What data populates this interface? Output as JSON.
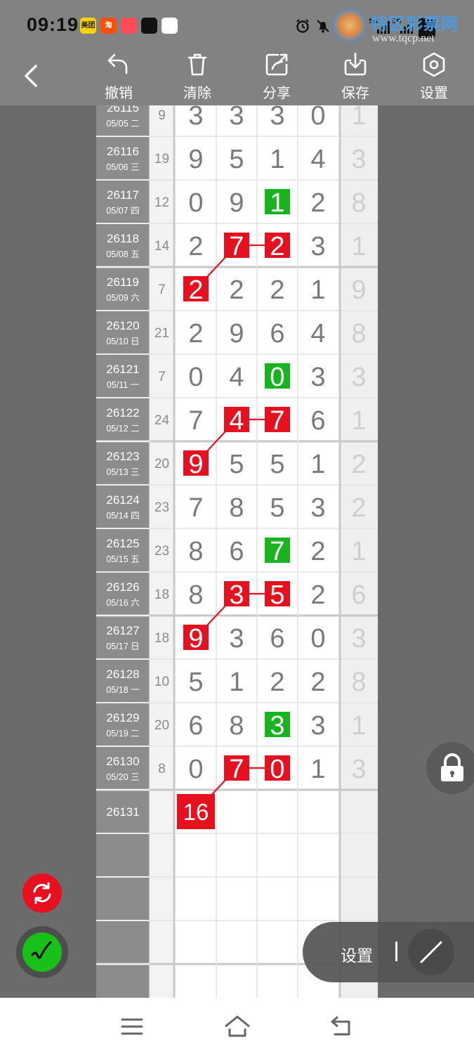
{
  "status_bar": {
    "time": "09:19",
    "apps": [
      {
        "icon": "meituan-icon",
        "label": "美团",
        "color": "#ffd100",
        "text_color": "#222"
      },
      {
        "icon": "taobao-icon",
        "label": "淘",
        "color": "#ff5000",
        "text_color": "#fff"
      },
      {
        "icon": "kuaishou-icon",
        "label": "",
        "color": "#ff4a5a",
        "text_color": "#fff"
      },
      {
        "icon": "douyin-icon",
        "label": "",
        "color": "#111111",
        "text_color": "#fff"
      },
      {
        "icon": "baidu-icon",
        "label": "",
        "color": "#ffffff",
        "text_color": "#2b5fd9"
      }
    ],
    "right_icons": [
      "alarm-icon",
      "mute-icon",
      "5g-signal-icon",
      "5g-signal-icon",
      "battery-icon"
    ]
  },
  "watermark": {
    "title": "特区彩票网",
    "url": "www.tqcp.net"
  },
  "toolbar": {
    "back_icon": "back-arrow-icon",
    "buttons": [
      {
        "icon": "undo-icon",
        "label": "撤销"
      },
      {
        "icon": "trash-icon",
        "label": "清除"
      },
      {
        "icon": "share-icon",
        "label": "分享"
      },
      {
        "icon": "save-icon",
        "label": "保存"
      },
      {
        "icon": "settings-icon",
        "label": "设置"
      }
    ]
  },
  "colors": {
    "red": "#e8101e",
    "green": "#17b41d",
    "digit": "#7a7a7a",
    "sum_digit": "#cfcfcf",
    "issue_bg": "#8c8c8c",
    "sum_col_bg": "#efefef"
  },
  "table": {
    "first_row_partial": true,
    "rows": [
      {
        "issue": "26115",
        "date": "05/05 二",
        "sum": "9",
        "digits": [
          "3",
          "3",
          "3",
          "0"
        ],
        "extra": "1"
      },
      {
        "issue": "26116",
        "date": "05/06 三",
        "sum": "19",
        "digits": [
          "9",
          "5",
          "1",
          "4"
        ],
        "extra": "3"
      },
      {
        "issue": "26117",
        "date": "05/07 四",
        "sum": "12",
        "digits": [
          "0",
          "9",
          "1",
          "2"
        ],
        "extra": "8"
      },
      {
        "issue": "26118",
        "date": "05/08 五",
        "sum": "14",
        "digits": [
          "2",
          "7",
          "2",
          "3"
        ],
        "extra": "1"
      },
      {
        "issue": "26119",
        "date": "05/09 六",
        "sum": "7",
        "digits": [
          "2",
          "2",
          "2",
          "1"
        ],
        "extra": "9"
      },
      {
        "issue": "26120",
        "date": "05/10 日",
        "sum": "21",
        "digits": [
          "2",
          "9",
          "6",
          "4"
        ],
        "extra": "8"
      },
      {
        "issue": "26121",
        "date": "05/11 一",
        "sum": "7",
        "digits": [
          "0",
          "4",
          "0",
          "3"
        ],
        "extra": "3"
      },
      {
        "issue": "26122",
        "date": "05/12 二",
        "sum": "24",
        "digits": [
          "7",
          "4",
          "7",
          "6"
        ],
        "extra": "1"
      },
      {
        "issue": "26123",
        "date": "05/13 三",
        "sum": "20",
        "digits": [
          "9",
          "5",
          "5",
          "1"
        ],
        "extra": "2"
      },
      {
        "issue": "26124",
        "date": "05/14 四",
        "sum": "23",
        "digits": [
          "7",
          "8",
          "5",
          "3"
        ],
        "extra": "2"
      },
      {
        "issue": "26125",
        "date": "05/15 五",
        "sum": "23",
        "digits": [
          "8",
          "6",
          "7",
          "2"
        ],
        "extra": "1"
      },
      {
        "issue": "26126",
        "date": "05/16 六",
        "sum": "18",
        "digits": [
          "8",
          "3",
          "5",
          "2"
        ],
        "extra": "6"
      },
      {
        "issue": "26127",
        "date": "05/17 日",
        "sum": "18",
        "digits": [
          "9",
          "3",
          "6",
          "0"
        ],
        "extra": "3"
      },
      {
        "issue": "26128",
        "date": "05/18 一",
        "sum": "10",
        "digits": [
          "5",
          "1",
          "2",
          "2"
        ],
        "extra": "8"
      },
      {
        "issue": "26129",
        "date": "05/19 二",
        "sum": "20",
        "digits": [
          "6",
          "8",
          "3",
          "3"
        ],
        "extra": "1"
      },
      {
        "issue": "26130",
        "date": "05/20 三",
        "sum": "8",
        "digits": [
          "0",
          "7",
          "0",
          "1"
        ],
        "extra": "3"
      },
      {
        "issue": "26131",
        "date": "",
        "sum": "",
        "digits": [
          "16",
          "",
          "",
          ""
        ],
        "extra": ""
      },
      {
        "issue": "",
        "date": "",
        "sum": "",
        "digits": [
          "",
          "",
          "",
          ""
        ],
        "extra": ""
      },
      {
        "issue": "",
        "date": "",
        "sum": "",
        "digits": [
          "",
          "",
          "",
          ""
        ],
        "extra": ""
      },
      {
        "issue": "",
        "date": "",
        "sum": "",
        "digits": [
          "",
          "",
          "",
          ""
        ],
        "extra": ""
      },
      {
        "issue": "",
        "date": "",
        "sum": "",
        "digits": [
          "",
          "",
          "",
          ""
        ],
        "extra": ""
      }
    ],
    "highlights": [
      {
        "row": 2,
        "col": 2,
        "color": "green"
      },
      {
        "row": 3,
        "col": 1,
        "color": "red"
      },
      {
        "row": 3,
        "col": 2,
        "color": "red"
      },
      {
        "row": 4,
        "col": 0,
        "color": "red"
      },
      {
        "row": 6,
        "col": 2,
        "color": "green"
      },
      {
        "row": 7,
        "col": 1,
        "color": "red"
      },
      {
        "row": 7,
        "col": 2,
        "color": "red"
      },
      {
        "row": 8,
        "col": 0,
        "color": "red"
      },
      {
        "row": 10,
        "col": 2,
        "color": "green"
      },
      {
        "row": 11,
        "col": 1,
        "color": "red"
      },
      {
        "row": 11,
        "col": 2,
        "color": "red"
      },
      {
        "row": 12,
        "col": 0,
        "color": "red"
      },
      {
        "row": 14,
        "col": 2,
        "color": "green"
      },
      {
        "row": 15,
        "col": 1,
        "color": "red"
      },
      {
        "row": 15,
        "col": 2,
        "color": "red"
      },
      {
        "row": 16,
        "col": 0,
        "color": "red"
      }
    ],
    "links": [
      {
        "from": [
          3,
          1
        ],
        "to": [
          3,
          2
        ]
      },
      {
        "from": [
          3,
          1
        ],
        "to": [
          4,
          0
        ]
      },
      {
        "from": [
          7,
          1
        ],
        "to": [
          7,
          2
        ]
      },
      {
        "from": [
          7,
          1
        ],
        "to": [
          8,
          0
        ]
      },
      {
        "from": [
          11,
          1
        ],
        "to": [
          11,
          2
        ]
      },
      {
        "from": [
          11,
          1
        ],
        "to": [
          12,
          0
        ]
      },
      {
        "from": [
          15,
          1
        ],
        "to": [
          15,
          2
        ]
      },
      {
        "from": [
          15,
          1
        ],
        "to": [
          16,
          0
        ]
      }
    ]
  },
  "floating": {
    "lock_icon": "lock-icon",
    "sync_icon": "sync-icon",
    "pen_icon": "pen-icon",
    "settings_label": "设置",
    "line_icon": "line-tool-icon"
  },
  "nav": {
    "icons": [
      "menu-icon",
      "home-icon",
      "back-icon"
    ]
  }
}
